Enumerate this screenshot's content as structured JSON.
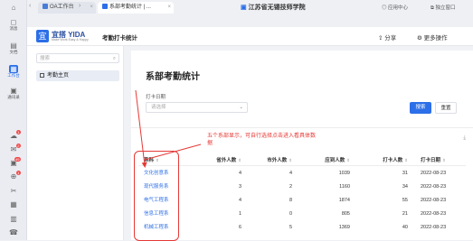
{
  "leftbar": {
    "items": [
      {
        "label": "消息",
        "icon": "chat-icon",
        "glyph": "◻"
      },
      {
        "label": "文档",
        "icon": "document-icon",
        "glyph": "▤"
      },
      {
        "label": "工作台",
        "icon": "workbench-icon",
        "glyph": "▦",
        "active": true
      },
      {
        "label": "通讯录",
        "icon": "contacts-icon",
        "glyph": "▣"
      }
    ],
    "apps": [
      {
        "icon": "cloud-icon",
        "glyph": "☁",
        "badge": "1"
      },
      {
        "icon": "mail-icon",
        "glyph": "✉",
        "badge": "2"
      },
      {
        "icon": "dashboard-icon",
        "glyph": "▣",
        "badge": "49"
      },
      {
        "icon": "cart-icon",
        "glyph": "⊕",
        "badge": "1"
      },
      {
        "icon": "tool-icon",
        "glyph": "✂",
        "badge": ""
      },
      {
        "icon": "grid-icon",
        "glyph": "▦",
        "badge": ""
      },
      {
        "icon": "calendar-icon",
        "glyph": "▥",
        "badge": ""
      },
      {
        "icon": "phone-icon",
        "glyph": "☎",
        "badge": ""
      }
    ]
  },
  "topbar": {
    "back": "‹",
    "forward": "›",
    "tabs": [
      {
        "title": "OA工作台",
        "active": false
      },
      {
        "title": "系部考勤统计 | ...",
        "active": true
      }
    ],
    "org_name": "江苏省无锡技师学院",
    "app_center": "应用中心",
    "standalone": "独立窗口"
  },
  "app_header": {
    "logo_name": "宜搭 YIDA",
    "logo_sub": "Make Work Easy & Happy",
    "title": "考勤打卡统计",
    "share": "分享",
    "more": "更多操作"
  },
  "side_panel": {
    "search_placeholder": "搜索",
    "items": [
      "考勤主页"
    ]
  },
  "main": {
    "page_title": "系部考勤统计",
    "filter_label": "打卡日期",
    "date_placeholder": "请选择",
    "search_btn": "搜索",
    "reset_btn": "重置",
    "annotation": "五个系部显示，可自行选择点击进入看具体数据",
    "table": {
      "headers": [
        "系科",
        "省外人数",
        "市外人数",
        "应到人数",
        "打卡人数",
        "打卡日期"
      ],
      "rows": [
        [
          "文化创意系",
          "4",
          "4",
          "1039",
          "31",
          "2022-08-23"
        ],
        [
          "现代服务系",
          "3",
          "2",
          "1160",
          "34",
          "2022-08-23"
        ],
        [
          "电气工程系",
          "4",
          "8",
          "1874",
          "55",
          "2022-08-23"
        ],
        [
          "信息工程系",
          "1",
          "0",
          "805",
          "21",
          "2022-08-23"
        ],
        [
          "机械工程系",
          "6",
          "5",
          "1369",
          "40",
          "2022-08-23"
        ]
      ]
    }
  },
  "colors": {
    "accent": "#2c6fe8",
    "annotation": "#e53935"
  }
}
